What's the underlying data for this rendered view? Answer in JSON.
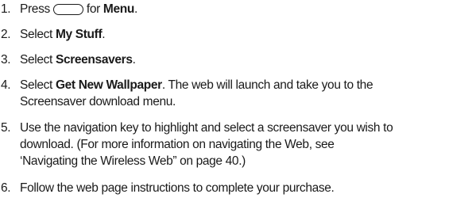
{
  "steps": [
    {
      "number": "1.",
      "pre": "Press",
      "icon": "menu-key-oval-icon",
      "post": "for",
      "bold": "Menu",
      "tail": "."
    },
    {
      "number": "2.",
      "pre": "Select",
      "bold": "My Stuff",
      "tail": "."
    },
    {
      "number": "3.",
      "pre": "Select",
      "bold": "Screensavers",
      "tail": "."
    },
    {
      "number": "4.",
      "pre": "Select",
      "bold": "Get New Wallpaper",
      "tail": ". The web will launch and take you to the",
      "line2": "Screensaver download menu."
    },
    {
      "number": "5.",
      "line1": "Use the navigation key to highlight and select a screensaver you wish to",
      "line2": "download. (For more information on navigating the Web, see",
      "line3": "‘Navigating the Wireless Web” on page 40.)"
    },
    {
      "number": "6.",
      "line1": "Follow the web page instructions to complete your purchase."
    }
  ]
}
